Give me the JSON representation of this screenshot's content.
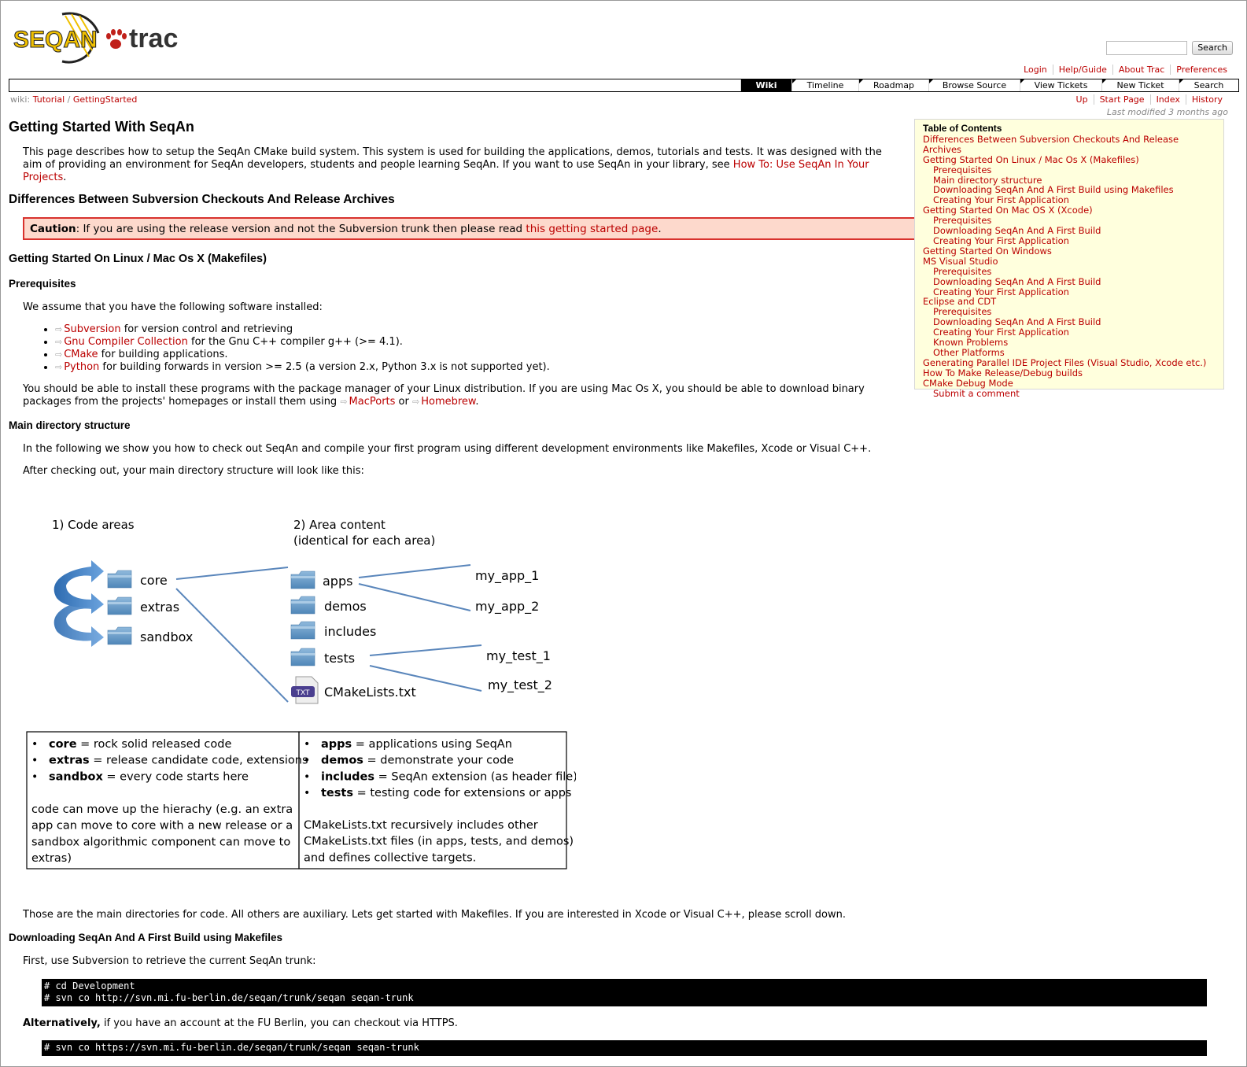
{
  "header": {
    "logo_left": "SEQAN",
    "logo_right": "trac",
    "search_placeholder": "",
    "search_button": "Search"
  },
  "metanav": [
    "Login",
    "Help/Guide",
    "About Trac",
    "Preferences"
  ],
  "mainnav": [
    {
      "label": "Wiki",
      "active": true
    },
    {
      "label": "Timeline"
    },
    {
      "label": "Roadmap"
    },
    {
      "label": "Browse Source"
    },
    {
      "label": "View Tickets"
    },
    {
      "label": "New Ticket"
    },
    {
      "label": "Search"
    }
  ],
  "breadcrumb": {
    "prefix": "wiki:",
    "items": [
      "Tutorial",
      "GettingStarted"
    ]
  },
  "ctxtnav": [
    "Up",
    "Start Page",
    "Index",
    "History"
  ],
  "last_modified": "Last modified 3 months ago",
  "page": {
    "title": "Getting Started With SeqAn",
    "intro": "This page describes how to setup the SeqAn CMake build system. This system is used for building the applications, demos, tutorials and tests. It was designed with the aim of providing an environment for SeqAn developers, students and people learning SeqAn. If you want to use SeqAn in your library, see ",
    "intro_link": "How To: Use SeqAn In Your Projects",
    "h_differences": "Differences Between Subversion Checkouts And Release Archives",
    "caution_label": "Caution",
    "caution_text": ": If you are using the release version and not the Subversion trunk then please read ",
    "caution_link": "this getting started page",
    "h_linux": "Getting Started On Linux / Mac Os X (Makefiles)",
    "h_prereq": "Prerequisites",
    "prereq_intro": "We assume that you have the following software installed:",
    "software": [
      {
        "name": "Subversion",
        "desc": " for version control and retrieving"
      },
      {
        "name": "Gnu Compiler Collection",
        "desc": " for the Gnu C++ compiler g++ (>= 4.1)."
      },
      {
        "name": "CMake",
        "desc": " for building applications."
      },
      {
        "name": "Python",
        "desc": " for building forwards in version >= 2.5 (a version 2.x, Python 3.x is not supported yet)."
      }
    ],
    "install_text1": "You should be able to install these programs with the package manager of your Linux distribution. If you are using Mac Os X, you should be able to download binary packages from the projects' homepages or install them using ",
    "macports": "MacPorts",
    "or": " or ",
    "homebrew": "Homebrew",
    "h_maindir": "Main directory structure",
    "maindir_p1": "In the following we show you how to check out SeqAn and compile your first program using different development environments like Makefiles, Xcode or Visual C++.",
    "maindir_p2": "After checking out, your main directory structure will look like this:",
    "after_diagram": "Those are the main directories for code. All others are auxiliary. Lets get started with Makefiles. If you are interested in Xcode or Visual C++, please scroll down.",
    "h_download": "Downloading SeqAn And A First Build using Makefiles",
    "download_p": "First, use Subversion to retrieve the current SeqAn trunk:",
    "code1": [
      "# cd Development",
      "# svn co http://svn.mi.fu-berlin.de/seqan/trunk/seqan seqan-trunk"
    ],
    "alt_bold": "Alternatively,",
    "alt_text": " if you have an account at the FU Berlin, you can checkout via HTTPS.",
    "code2": [
      "# svn co https://svn.mi.fu-berlin.de/seqan/trunk/seqan seqan-trunk"
    ]
  },
  "toc": {
    "title": "Table of Contents",
    "items": [
      {
        "label": "Differences Between Subversion Checkouts And Release Archives",
        "level": 1
      },
      {
        "label": "Getting Started On Linux / Mac Os X (Makefiles)",
        "level": 1
      },
      {
        "label": "Prerequisites",
        "level": 2
      },
      {
        "label": "Main directory structure",
        "level": 2
      },
      {
        "label": "Downloading SeqAn And A First Build using Makefiles",
        "level": 2
      },
      {
        "label": "Creating Your First Application",
        "level": 2
      },
      {
        "label": "Getting Started On Mac OS X (Xcode)",
        "level": 1
      },
      {
        "label": "Prerequisites",
        "level": 2
      },
      {
        "label": "Downloading SeqAn And A First Build",
        "level": 2
      },
      {
        "label": "Creating Your First Application",
        "level": 2
      },
      {
        "label": "Getting Started On Windows",
        "level": 1
      },
      {
        "label": "MS Visual Studio",
        "level": 1
      },
      {
        "label": "Prerequisites",
        "level": 2
      },
      {
        "label": "Downloading SeqAn And A First Build",
        "level": 2
      },
      {
        "label": "Creating Your First Application",
        "level": 2
      },
      {
        "label": "Eclipse and CDT",
        "level": 1
      },
      {
        "label": "Prerequisites",
        "level": 2
      },
      {
        "label": "Downloading SeqAn And A First Build",
        "level": 2
      },
      {
        "label": "Creating Your First Application",
        "level": 2
      },
      {
        "label": "Known Problems",
        "level": 2
      },
      {
        "label": "Other Platforms",
        "level": 2
      },
      {
        "label": "Generating Parallel IDE Project Files (Visual Studio, Xcode etc.)",
        "level": 1
      },
      {
        "label": "How To Make Release/Debug builds",
        "level": 1
      },
      {
        "label": "CMake Debug Mode",
        "level": 1
      },
      {
        "label": "Submit a comment",
        "level": 2
      }
    ]
  },
  "diagram": {
    "h1": "1) Code areas",
    "h2a": "2) Area content",
    "h2b": "(identical for each area)",
    "areas": [
      "core",
      "extras",
      "sandbox"
    ],
    "contents": [
      "apps",
      "demos",
      "includes",
      "tests",
      "CMakeLists.txt"
    ],
    "txt_badge": "TXT",
    "leaves": [
      "my_app_1",
      "my_app_2",
      "my_test_1",
      "my_test_2"
    ],
    "left_box": {
      "bullets": [
        {
          "b": "core",
          "t": " = rock solid released code"
        },
        {
          "b": "extras",
          "t": " = release candidate code, extensions"
        },
        {
          "b": "sandbox",
          "t": " = every code starts here"
        }
      ],
      "lines": [
        "code can move up the hierachy (e.g. an extra",
        "app can move to core with a new release or a",
        "sandbox algorithmic component can move to",
        "extras)"
      ]
    },
    "right_box": {
      "bullets": [
        {
          "b": "apps",
          "t": " = applications using SeqAn"
        },
        {
          "b": "demos",
          "t": " = demonstrate your code"
        },
        {
          "b": "includes",
          "t": " = SeqAn extension (as header file)"
        },
        {
          "b": "tests",
          "t": " = testing code for extensions or apps"
        }
      ],
      "lines": [
        "CMakeLists.txt recursively includes other",
        "CMakeLists.txt files (in apps, tests, and demos)",
        "and defines collective targets."
      ]
    }
  }
}
